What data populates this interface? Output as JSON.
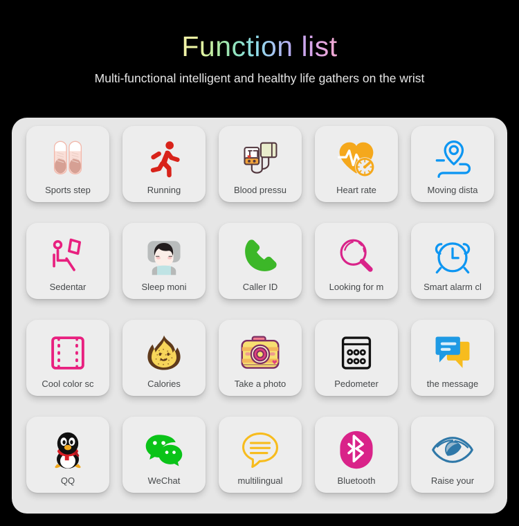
{
  "header": {
    "title": "Function list",
    "subtitle": "Multi-functional intelligent and healthy life gathers on the wrist"
  },
  "colors": {
    "background": "#000000",
    "panel": "#e6e6e6",
    "card": "#ededed",
    "label_text": "#45484a",
    "subtitle_text": "#e6e6e6",
    "red": "#d8231a",
    "orange": "#f5a81c",
    "pink": "#e8207f",
    "magenta": "#d92389",
    "green": "#3cb728",
    "wechat_green": "#1fc413",
    "blue": "#0d96f2",
    "eye_blue": "#2f78a8",
    "yellow": "#f7bc1e",
    "black": "#111111"
  },
  "grid": {
    "columns": 5,
    "rows": 4,
    "items": [
      {
        "icon": "sneakers-icon",
        "label": "Sports step"
      },
      {
        "icon": "running-icon",
        "label": "Running"
      },
      {
        "icon": "blood-pressure-icon",
        "label": "Blood pressu"
      },
      {
        "icon": "heart-rate-icon",
        "label": "Heart rate"
      },
      {
        "icon": "moving-distance-icon",
        "label": "Moving dista"
      },
      {
        "icon": "sedentary-icon",
        "label": "Sedentar"
      },
      {
        "icon": "sleep-monitor-icon",
        "label": "Sleep moni"
      },
      {
        "icon": "phone-icon",
        "label": "Caller ID"
      },
      {
        "icon": "magnifier-icon",
        "label": "Looking for m"
      },
      {
        "icon": "alarm-clock-icon",
        "label": "Smart alarm cl"
      },
      {
        "icon": "film-strip-icon",
        "label": "Cool color sc"
      },
      {
        "icon": "flame-icon",
        "label": "Calories"
      },
      {
        "icon": "camera-icon",
        "label": "Take a photo"
      },
      {
        "icon": "pedometer-icon",
        "label": "Pedometer"
      },
      {
        "icon": "message-icon",
        "label": "the message"
      },
      {
        "icon": "qq-penguin-icon",
        "label": "QQ"
      },
      {
        "icon": "wechat-icon",
        "label": "WeChat"
      },
      {
        "icon": "multilingual-icon",
        "label": "multilingual"
      },
      {
        "icon": "bluetooth-icon",
        "label": "Bluetooth"
      },
      {
        "icon": "raise-wrist-eye-icon",
        "label": "Raise your"
      }
    ]
  }
}
